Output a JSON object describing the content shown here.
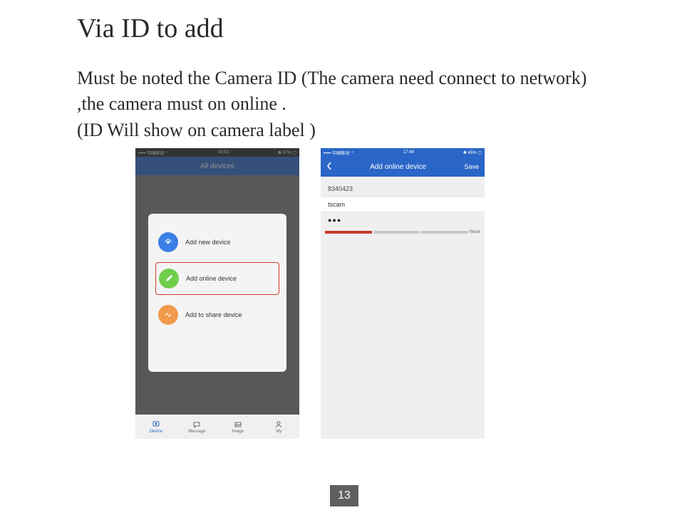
{
  "title": "Via ID to add",
  "paragraph1": "Must be noted the Camera ID (The camera need connect to network) ,the camera must on online .",
  "paragraph2": "(ID Will show on camera label )",
  "page_number": "13",
  "phone1": {
    "status_left": "••••• 中国移动 ⌃",
    "status_time": "16:53",
    "status_right": "✽ 57% ▢",
    "nav_title": "All devices",
    "sheet": {
      "row1": "Add new device",
      "row2": "Add online device",
      "row3": "Add to share device"
    },
    "tabs": {
      "device": "Device",
      "message": "Message",
      "image": "Image",
      "my": "My"
    }
  },
  "phone2": {
    "status_left": "••••• 中国移动 ⌃",
    "status_time": "17:48",
    "status_right": "✽ 45% ▢",
    "nav_title": "Add online device",
    "nav_save": "Save",
    "device_id": "8340423",
    "device_name": "tscam",
    "password_masked": "●●●",
    "strength_label": "Weak"
  }
}
